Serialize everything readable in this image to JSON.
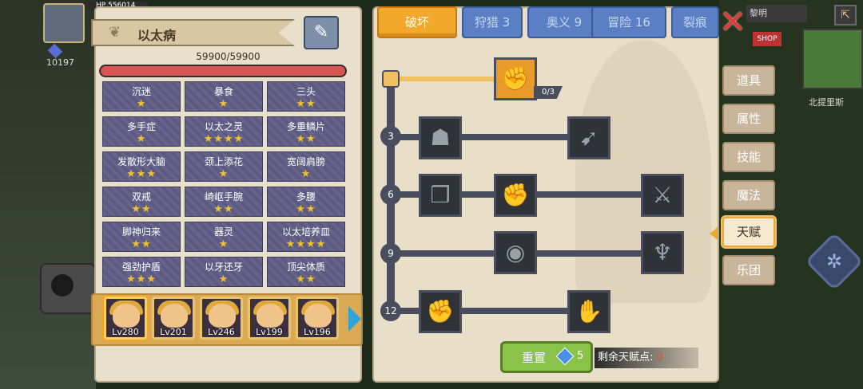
{
  "hud": {
    "hp_label": "HP",
    "hp_value": "556014",
    "gold": "10197"
  },
  "trait_panel": {
    "title": "以太病",
    "hp": "59900/59900",
    "hp_fraction": 1.0,
    "traits": [
      {
        "name": "沉迷",
        "stars": "★"
      },
      {
        "name": "暴食",
        "stars": "★"
      },
      {
        "name": "三头",
        "stars": "★★"
      },
      {
        "name": "多手症",
        "stars": "★"
      },
      {
        "name": "以太之灵",
        "stars": "★★★★"
      },
      {
        "name": "多重鳞片",
        "stars": "★★"
      },
      {
        "name": "发散形大脑",
        "stars": "★★★"
      },
      {
        "name": "颈上添花",
        "stars": "★"
      },
      {
        "name": "宽阔肩膀",
        "stars": "★"
      },
      {
        "name": "双戒",
        "stars": "★★"
      },
      {
        "name": "崎岖手腕",
        "stars": "★★"
      },
      {
        "name": "多腰",
        "stars": "★★"
      },
      {
        "name": "脚神归来",
        "stars": "★★"
      },
      {
        "name": "器灵",
        "stars": "★"
      },
      {
        "name": "以太培养皿",
        "stars": "★★★★"
      },
      {
        "name": "强劲护盾",
        "stars": "★★★"
      },
      {
        "name": "以牙还牙",
        "stars": "★"
      },
      {
        "name": "顶尖体质",
        "stars": "★★"
      }
    ]
  },
  "heroes": [
    {
      "level": "Lv280"
    },
    {
      "level": "Lv201"
    },
    {
      "level": "Lv246"
    },
    {
      "level": "Lv199"
    },
    {
      "level": "Lv196"
    }
  ],
  "tabs": [
    {
      "label": "破坏"
    },
    {
      "label": "狩猎 3"
    },
    {
      "label": "奥义 9"
    },
    {
      "label": "冒险 16"
    },
    {
      "label": "裂痕"
    }
  ],
  "side_tabs": [
    "道具",
    "属性",
    "技能",
    "魔法",
    "天赋",
    "乐团"
  ],
  "talent_tree": {
    "row_levels": [
      "3",
      "6",
      "9",
      "12"
    ],
    "top_node_count": "0/3",
    "top_node_icon": "handshake-icon",
    "colors": {
      "accent": "#f1a82b",
      "node_dark": "#2f3236",
      "branch": "#4a4d5e"
    }
  },
  "footer": {
    "reset_label": "重置",
    "reset_cost": "5",
    "points_label": "剩余天赋点:",
    "points_value": "0"
  },
  "world": {
    "town_label": "北提里斯",
    "shop_label": "SHOP",
    "chip_label": "黎明"
  }
}
